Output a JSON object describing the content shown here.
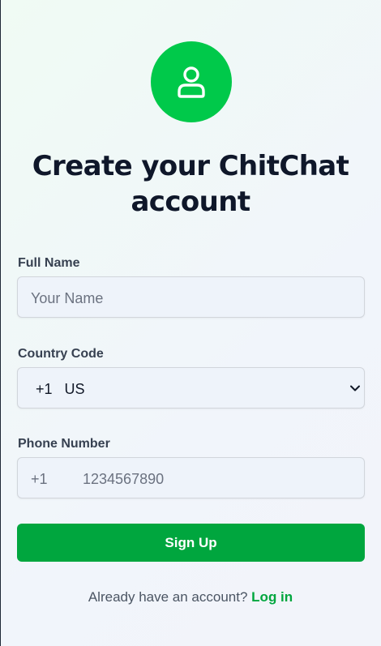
{
  "header": {
    "avatar_icon": "user-icon",
    "title": "Create your ChitChat account"
  },
  "form": {
    "full_name_label": "Full Name",
    "full_name_placeholder": "Your Name",
    "country_code_label": "Country Code",
    "country_code_value": "+1   US",
    "phone_label": "Phone Number",
    "phone_prefix": "+1",
    "phone_placeholder": "1234567890",
    "submit_label": "Sign Up"
  },
  "footer": {
    "prompt": "Already have an account?",
    "login_link": "Log in"
  },
  "colors": {
    "accent": "#00c94a",
    "button": "#00a63e",
    "link": "#00a63e"
  }
}
